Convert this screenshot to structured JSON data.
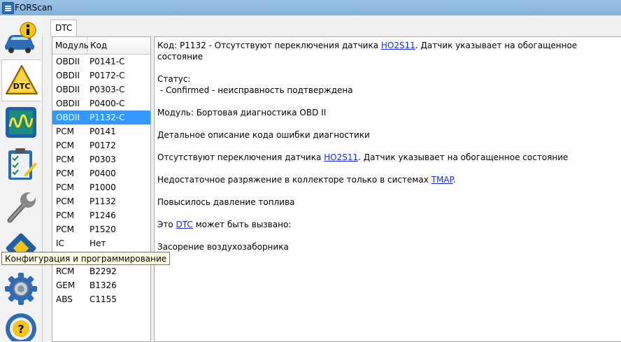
{
  "window": {
    "title": "FORScan"
  },
  "tabs": [
    {
      "label": "DTC"
    }
  ],
  "sidebar": {
    "items": [
      {
        "icon": "car-info-icon"
      },
      {
        "icon": "dtc-warning-icon",
        "active": true
      },
      {
        "icon": "oscilloscope-icon"
      },
      {
        "icon": "checklist-icon"
      },
      {
        "icon": "wrench-icon"
      },
      {
        "icon": "chip-icon"
      },
      {
        "icon": "gear-icon"
      },
      {
        "icon": "help-steering-wheel-icon"
      }
    ],
    "tooltip": "Конфигурация и программирование"
  },
  "dtc_list": {
    "headers": {
      "module": "Модуль",
      "code": "Код"
    },
    "rows": [
      {
        "module": "OBDII",
        "code": "P0141-C"
      },
      {
        "module": "OBDII",
        "code": "P0172-C"
      },
      {
        "module": "OBDII",
        "code": "P0303-C"
      },
      {
        "module": "OBDII",
        "code": "P0400-C"
      },
      {
        "module": "OBDII",
        "code": "P1132-C",
        "selected": true
      },
      {
        "module": "PCM",
        "code": "P0141"
      },
      {
        "module": "PCM",
        "code": "P0172"
      },
      {
        "module": "PCM",
        "code": "P0303"
      },
      {
        "module": "PCM",
        "code": "P0400"
      },
      {
        "module": "PCM",
        "code": "P1000"
      },
      {
        "module": "PCM",
        "code": "P1132"
      },
      {
        "module": "PCM",
        "code": "P1246"
      },
      {
        "module": "PCM",
        "code": "P1520"
      },
      {
        "module": "IC",
        "code": "Нет"
      },
      {
        "module": "",
        "code": ""
      },
      {
        "module": "RCM",
        "code": "B2292"
      },
      {
        "module": "GEM",
        "code": "B1326"
      },
      {
        "module": "ABS",
        "code": "C1155"
      }
    ]
  },
  "detail": {
    "code_line": {
      "prefix": "Код: P1132 - Отсутствуют переключения датчика ",
      "link": "HO2S11",
      "suffix": ". Датчик указывает на обогащенное состояние"
    },
    "status_label": "Статус:",
    "status_value": " - Confirmed - неисправность подтверждена",
    "module_line": "Модуль: Бортовая диагностика OBD II",
    "description_title": "Детальное описание кода ошибки диагностики",
    "desc_line": {
      "prefix": "Отсутствуют переключения датчика ",
      "link": "HO2S11",
      "suffix": ". Датчик указывает на обогащенное состояние"
    },
    "vacuum_line": {
      "prefix": "Недостаточное разряжение в коллекторе только в системах ",
      "link": "TMAP",
      "suffix": "."
    },
    "fuel_line": "Повысилось давление топлива",
    "cause_line": {
      "prefix": "Это ",
      "link": "DTC",
      "suffix": " может быть вызвано:"
    },
    "cause_item": "Засорение воздухозаборника"
  },
  "colors": {
    "selection": "#3399ff",
    "link": "#1a2fd6",
    "tooltip_bg": "#ffffe1"
  }
}
